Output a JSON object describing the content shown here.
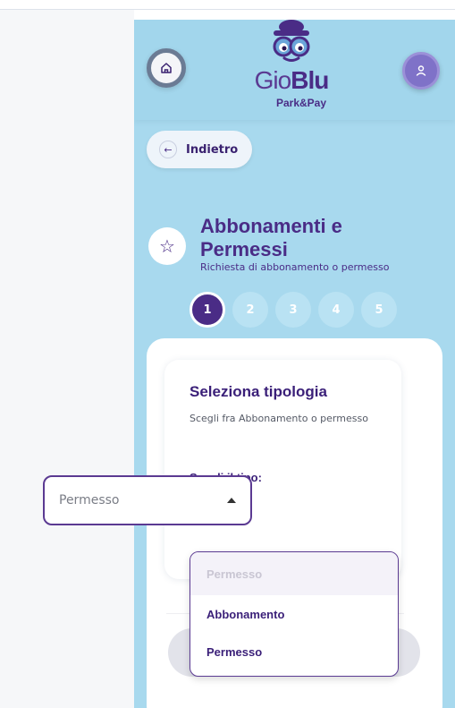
{
  "header": {
    "logo_gio": "Gio",
    "logo_blu": "Blu",
    "logo_sub": "Park&Pay",
    "icons": {
      "home": "home-icon",
      "user": "user-icon",
      "mascot": "mascot-logo"
    }
  },
  "nav": {
    "back_label": "Indietro",
    "back_icon": "arrow-left-icon"
  },
  "section": {
    "icon": "star-icon",
    "title_line1": "Abbonamenti e",
    "title_line2": "Permessi",
    "subtitle": "Richiesta di abbonamento o permesso"
  },
  "steps": [
    {
      "label": "1",
      "active": true
    },
    {
      "label": "2",
      "active": false
    },
    {
      "label": "3",
      "active": false
    },
    {
      "label": "4",
      "active": false
    },
    {
      "label": "5",
      "active": false
    }
  ],
  "card": {
    "title": "Seleziona tipologia",
    "description": "Scegli fra Abbonamento o permesso",
    "field_label": "Scegli il tipo:",
    "select_value": "Permesso"
  },
  "dropdown": {
    "placeholder": "Permesso",
    "options": [
      "Abbonamento",
      "Permesso"
    ]
  },
  "colors": {
    "app_bg": "#a8d9ee",
    "primary": "#4a2c86",
    "accent": "#7f72c8"
  }
}
